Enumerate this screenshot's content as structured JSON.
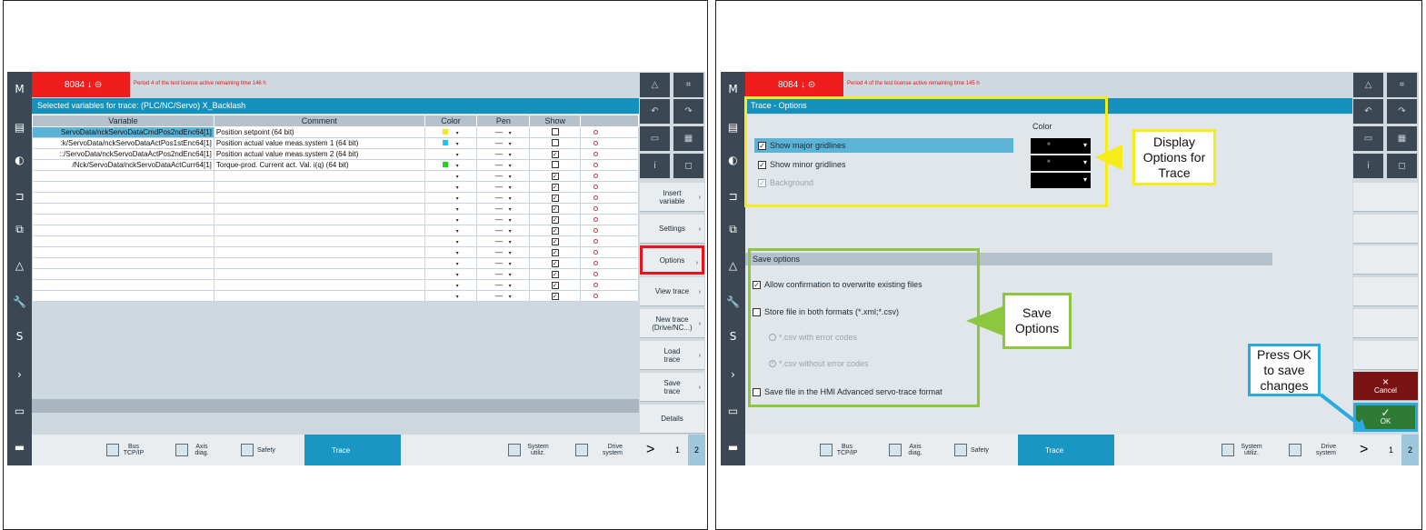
{
  "panel1": {
    "header": {
      "code": "8084",
      "license_text": "Period 4 of the test license active remaining time 146 h"
    },
    "title": "Selected variables for trace:  (PLC/NC/Servo) X_Backlash",
    "table": {
      "headers": [
        "Variable",
        "Comment",
        "Color",
        "Pen",
        "Show"
      ],
      "rows": [
        {
          "variable": "ServoData/nckServoDataCmdPos2ndEnc64[1]",
          "comment": "Position setpoint (64 bit)",
          "color": "#f5e51a",
          "pen": "—",
          "show": false
        },
        {
          "variable": ":k/ServoData/nckServoDataActPos1stEnc64[1]",
          "comment": "Position actual value meas.system 1 (64 bit)",
          "color": "#26c4e8",
          "pen": "—",
          "show": false
        },
        {
          "variable": "::/ServoData/nckServoDataActPos2ndEnc64[1]",
          "comment": "Position actual value meas.system 2 (64 bit)",
          "color": "#ffffff",
          "pen": "—",
          "show": true
        },
        {
          "variable": "/Nck/ServoData/nckServoDataActCurr64[1]",
          "comment": "Torque-prod. Current act. Val. i(q) (64 bit)",
          "color": "#22d41e",
          "pen": "—",
          "show": false
        }
      ],
      "empty_rows": 12
    },
    "softkeys": [
      "Insert variable",
      "Settings",
      "Options",
      "View trace",
      "New trace (Drive/NC...)",
      "Load trace",
      "Save trace",
      "Details"
    ]
  },
  "panel2": {
    "header": {
      "code": "8084",
      "license_text": "Period 4 of the test license active remaining time 145 h"
    },
    "title": "Trace - Options",
    "color_label": "Color",
    "gridlines": [
      {
        "label": "Show major gridlines",
        "checked": true
      },
      {
        "label": "Show minor gridlines",
        "checked": true
      },
      {
        "label": "Background",
        "checked": true
      }
    ],
    "save_options_title": "Save options",
    "save_options": {
      "allow_confirm": "Allow confirmation to overwrite existing files",
      "store_both": "Store file in both formats (*.xml;*.csv)",
      "csv_with": "*.csv with error codes",
      "csv_without": "*.csv without error codes",
      "hmi_format": "Save file in the HMI Advanced servo-trace format"
    },
    "cancel_label": "Cancel",
    "ok_label": "OK"
  },
  "bottom_nav": {
    "bus": "Bus TCP/IP",
    "axis": "Axis diag.",
    "safety": "Safety",
    "trace": "Trace",
    "system": "System utiliz.",
    "drive": "Drive system",
    "next": ">",
    "page1": "1",
    "page2": "2"
  },
  "callouts": {
    "display": "Display Options for Trace",
    "save": "Save Options",
    "ok": "Press OK to save changes"
  },
  "colors": {
    "yellow": "#f5ec1a",
    "green": "#8dc63f",
    "blue": "#29abe2",
    "red": "#e8141c"
  }
}
